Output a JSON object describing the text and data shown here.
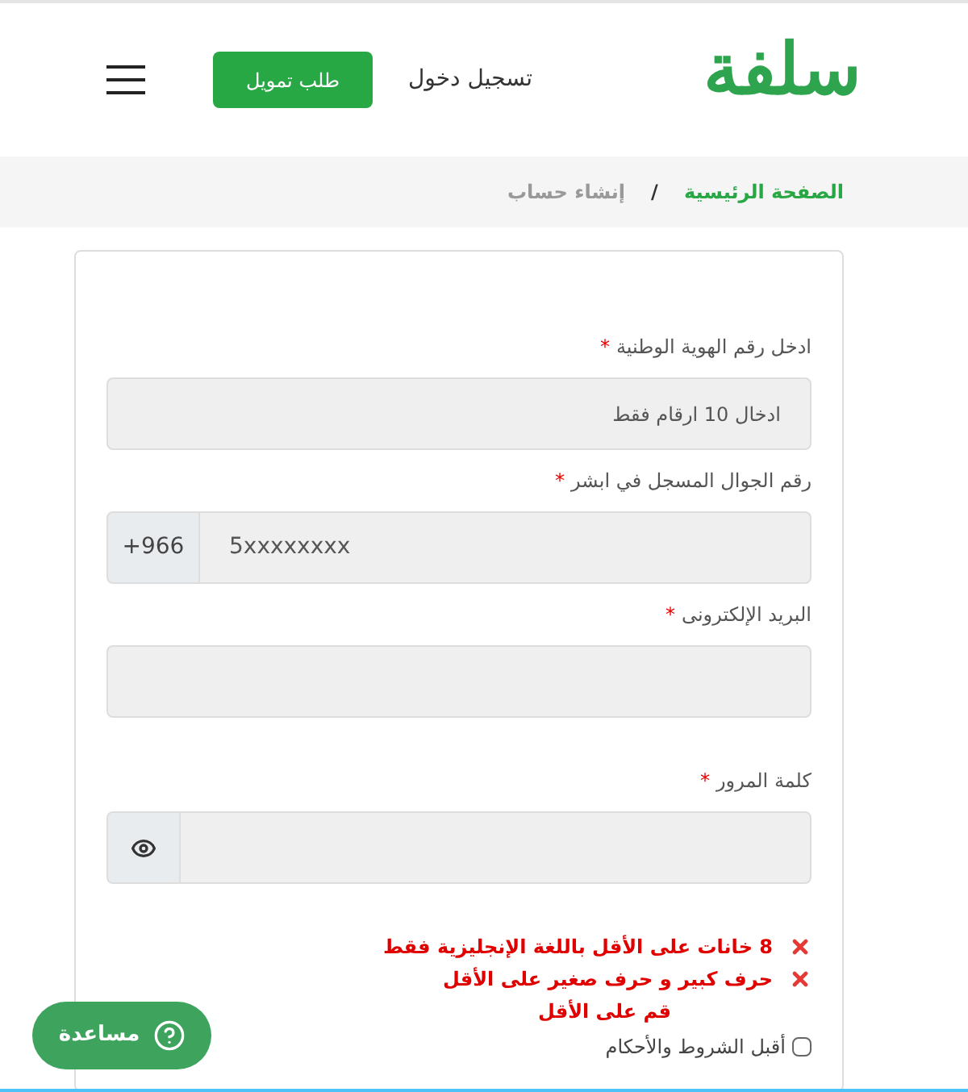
{
  "header": {
    "logo": "سلفة",
    "login_link": "تسجيل دخول",
    "apply_button": "طلب تمويل"
  },
  "breadcrumb": [
    {
      "label": "الصفحة الرئيسية",
      "selected": false
    },
    {
      "label": "إنشاء حساب",
      "selected": true
    }
  ],
  "breadcrumb_separator": "/",
  "form": {
    "fields": [
      {
        "kind": "text",
        "label": "ادخل رقم الهوية الوطنية",
        "required_mark": "*",
        "placeholder": "ادخال 10 ارقام فقط"
      },
      {
        "kind": "phone",
        "label": "رقم الجوال المسجل في ابشر",
        "required_mark": "*",
        "prefix": "+966",
        "placeholder": "5xxxxxxxx"
      },
      {
        "kind": "text",
        "label": "البريد الإلكترونى",
        "required_mark": "*"
      },
      {
        "kind": "password",
        "label": "كلمة المرور",
        "required_mark": "*"
      }
    ],
    "password_rules": [
      {
        "text": "8 خانات على الأقل باللغة الإنجليزية فقط",
        "met": false
      },
      {
        "text": "حرف كبير و حرف صغير على الأقل",
        "met": false
      },
      {
        "text": "قم على الأقل",
        "met": false
      }
    ],
    "terms": {
      "label": "أقبل الشروط والأحكام",
      "checked": false
    }
  },
  "help_button": "مساعدة"
}
